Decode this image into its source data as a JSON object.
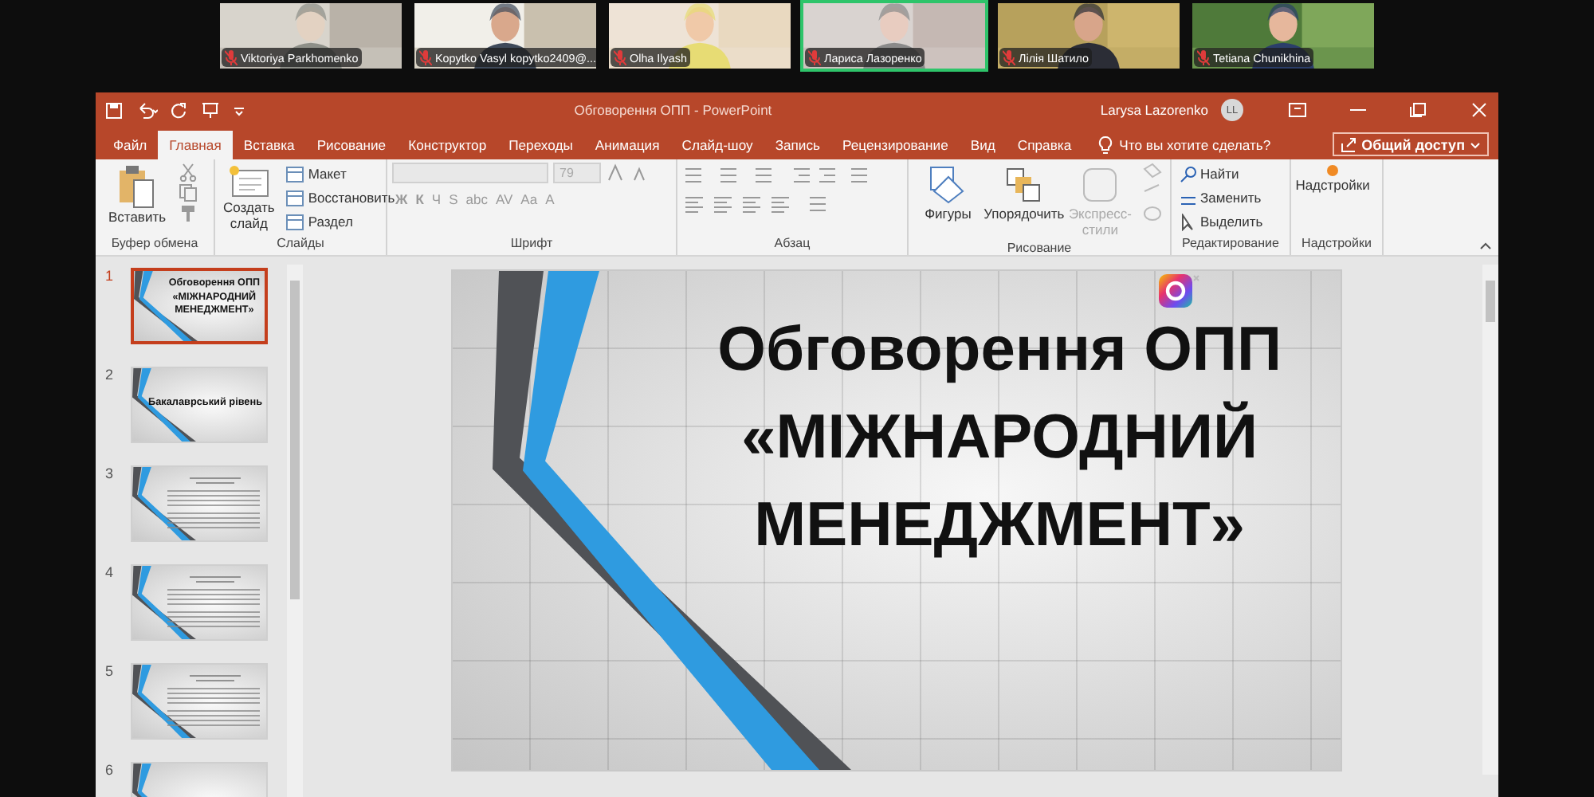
{
  "participants": [
    {
      "name": "Viktoriya Parkhomenko",
      "selected": false
    },
    {
      "name": "Kopytko Vasyl kopytko2409@...",
      "selected": false
    },
    {
      "name": "Olha Ilyash",
      "selected": false
    },
    {
      "name": "Лариса Лазоренко",
      "selected": true
    },
    {
      "name": "Лілія Шатило",
      "selected": false
    },
    {
      "name": "Tetiana Chunikhina",
      "selected": false
    }
  ],
  "window": {
    "title": "Обговорення ОПП  -  PowerPoint",
    "user": "Larysa Lazorenko",
    "avatar": "LL"
  },
  "tabs": [
    {
      "label": "Файл",
      "selected": false
    },
    {
      "label": "Главная",
      "selected": true
    },
    {
      "label": "Вставка",
      "selected": false
    },
    {
      "label": "Рисование",
      "selected": false
    },
    {
      "label": "Конструктор",
      "selected": false
    },
    {
      "label": "Переходы",
      "selected": false
    },
    {
      "label": "Анимация",
      "selected": false
    },
    {
      "label": "Слайд-шоу",
      "selected": false
    },
    {
      "label": "Запись",
      "selected": false
    },
    {
      "label": "Рецензирование",
      "selected": false
    },
    {
      "label": "Вид",
      "selected": false
    },
    {
      "label": "Справка",
      "selected": false
    }
  ],
  "tell_me": "Что вы хотите сделать?",
  "share": "Общий доступ",
  "ribbon": [
    {
      "kind": "clipboard",
      "label": "Буфер обмена",
      "items": [
        {
          "kind": "large",
          "label": "Вставить",
          "disabled": false
        }
      ]
    },
    {
      "kind": "slides",
      "label": "Слайды",
      "items": [
        {
          "kind": "large",
          "label": "Создать слайд",
          "disabled": false
        },
        {
          "kind": "small",
          "label": "Макет",
          "disabled": false
        },
        {
          "kind": "small",
          "label": "Восстановить",
          "disabled": false
        },
        {
          "kind": "small",
          "label": "Раздел",
          "disabled": false
        }
      ]
    },
    {
      "kind": "font",
      "label": "Шрифт",
      "size": "79",
      "format_buttons": [
        "Ж",
        "К",
        "Ч",
        "S",
        "abc",
        "AV",
        "Aa",
        "A"
      ]
    },
    {
      "kind": "paragraph",
      "label": "Абзац"
    },
    {
      "kind": "drawing",
      "label": "Рисование",
      "items": [
        {
          "kind": "large",
          "label": "Фигуры",
          "disabled": false
        },
        {
          "kind": "large",
          "label": "Упорядочить",
          "disabled": false
        },
        {
          "kind": "large",
          "label": "Экспресс-стили",
          "disabled": true
        }
      ]
    },
    {
      "kind": "editing",
      "label": "Редактирование",
      "items": [
        {
          "kind": "small",
          "label": "Найти",
          "disabled": false
        },
        {
          "kind": "small",
          "label": "Заменить",
          "disabled": false
        },
        {
          "kind": "small",
          "label": "Выделить",
          "disabled": false
        }
      ]
    },
    {
      "kind": "addins",
      "label": "Надстройки",
      "items": [
        {
          "kind": "large",
          "label": "Надстройки",
          "disabled": false
        }
      ]
    }
  ],
  "slides": [
    {
      "number": "1",
      "kind": "title",
      "lines": [
        "Обговорення ОПП",
        "«МІЖНАРОДНИЙ",
        "МЕНЕДЖМЕНТ»"
      ],
      "selected": true
    },
    {
      "number": "2",
      "kind": "heading",
      "lines": [
        "Бакалаврський рівень"
      ],
      "selected": false
    },
    {
      "number": "3",
      "kind": "text",
      "selected": false
    },
    {
      "number": "4",
      "kind": "text",
      "selected": false
    },
    {
      "number": "5",
      "kind": "text",
      "selected": false
    },
    {
      "number": "6",
      "kind": "plain",
      "selected": false
    }
  ],
  "main_slide": {
    "title_lines": [
      "Обговорення ОПП",
      "«МІЖНАРОДНИЙ",
      "МЕНЕДЖМЕНТ»"
    ]
  }
}
